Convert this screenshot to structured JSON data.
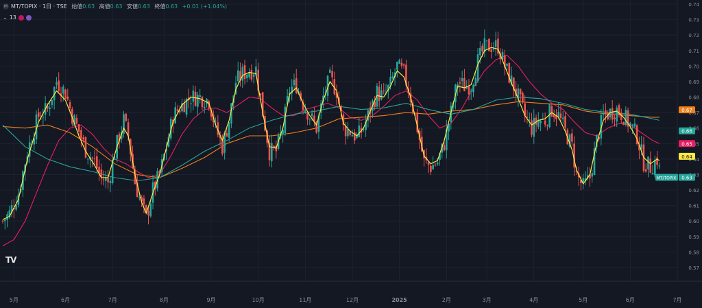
{
  "legend": {
    "symbol": "MT/TOPIX · 1日 · TSE",
    "open_label": "始値",
    "open": "0.63",
    "high_label": "高値",
    "high": "0.63",
    "low_label": "安値",
    "low": "0.63",
    "close_label": "終値",
    "close": "0.63",
    "change": "+0.01 (+1.04%)",
    "indicator_count": "13"
  },
  "colors": {
    "background": "#141823",
    "up": "#26a69a",
    "down": "#ef5350",
    "ma_fast": "#fbe945",
    "ma_teal": "#26a69a",
    "ma_orange": "#f0801c",
    "ma_pink": "#e91e63",
    "grid": "#1e2230",
    "axis_text": "#8b8f9a"
  },
  "icons": [
    "red-indicator-icon",
    "purple-indicator-icon"
  ],
  "chart_data": {
    "type": "candlestick",
    "title": "MT/TOPIX · 1日 · TSE",
    "ylim": [
      0.57,
      0.74
    ],
    "y_ticks": [
      "0.74",
      "0.73",
      "0.72",
      "0.71",
      "0.70",
      "0.69",
      "0.68",
      "0.67",
      "0.66",
      "0.65",
      "0.64",
      "0.63",
      "0.62",
      "0.61",
      "0.60",
      "0.59",
      "0.58",
      "0.57"
    ],
    "x_ticks": [
      "5月",
      "6月",
      "7月",
      "8月",
      "9月",
      "10月",
      "11月",
      "12月",
      "2025",
      "2月",
      "3月",
      "4月",
      "5月",
      "6月",
      "7月"
    ],
    "x_range": [
      0,
      301
    ],
    "last_bar_index": 293,
    "tick_positions": [
      5,
      28,
      49,
      72,
      93,
      114,
      135,
      156,
      177,
      198,
      216,
      237,
      259,
      280,
      301
    ],
    "price_path": [
      [
        0,
        0.6
      ],
      [
        3,
        0.605
      ],
      [
        7,
        0.618
      ],
      [
        11,
        0.645
      ],
      [
        16,
        0.668
      ],
      [
        20,
        0.672
      ],
      [
        24,
        0.69
      ],
      [
        28,
        0.683
      ],
      [
        31,
        0.668
      ],
      [
        34,
        0.658
      ],
      [
        37,
        0.646
      ],
      [
        41,
        0.638
      ],
      [
        44,
        0.628
      ],
      [
        47,
        0.625
      ],
      [
        51,
        0.65
      ],
      [
        54,
        0.665
      ],
      [
        56,
        0.655
      ],
      [
        59,
        0.625
      ],
      [
        62,
        0.61
      ],
      [
        64,
        0.602
      ],
      [
        67,
        0.62
      ],
      [
        70,
        0.63
      ],
      [
        73,
        0.648
      ],
      [
        76,
        0.668
      ],
      [
        80,
        0.675
      ],
      [
        84,
        0.68
      ],
      [
        88,
        0.68
      ],
      [
        92,
        0.678
      ],
      [
        95,
        0.66
      ],
      [
        98,
        0.648
      ],
      [
        101,
        0.665
      ],
      [
        104,
        0.69
      ],
      [
        107,
        0.695
      ],
      [
        110,
        0.697
      ],
      [
        113,
        0.698
      ],
      [
        116,
        0.67
      ],
      [
        119,
        0.645
      ],
      [
        122,
        0.645
      ],
      [
        125,
        0.66
      ],
      [
        128,
        0.685
      ],
      [
        131,
        0.688
      ],
      [
        134,
        0.676
      ],
      [
        137,
        0.668
      ],
      [
        140,
        0.66
      ],
      [
        143,
        0.68
      ],
      [
        146,
        0.692
      ],
      [
        149,
        0.684
      ],
      [
        152,
        0.66
      ],
      [
        155,
        0.658
      ],
      [
        158,
        0.654
      ],
      [
        161,
        0.66
      ],
      [
        164,
        0.672
      ],
      [
        167,
        0.683
      ],
      [
        170,
        0.68
      ],
      [
        173,
        0.688
      ],
      [
        176,
        0.7
      ],
      [
        179,
        0.695
      ],
      [
        182,
        0.68
      ],
      [
        185,
        0.66
      ],
      [
        188,
        0.638
      ],
      [
        191,
        0.635
      ],
      [
        194,
        0.638
      ],
      [
        197,
        0.65
      ],
      [
        200,
        0.67
      ],
      [
        203,
        0.69
      ],
      [
        206,
        0.687
      ],
      [
        209,
        0.688
      ],
      [
        212,
        0.703
      ],
      [
        215,
        0.712
      ],
      [
        218,
        0.713
      ],
      [
        221,
        0.713
      ],
      [
        224,
        0.7
      ],
      [
        227,
        0.69
      ],
      [
        230,
        0.68
      ],
      [
        233,
        0.668
      ],
      [
        236,
        0.66
      ],
      [
        239,
        0.665
      ],
      [
        242,
        0.665
      ],
      [
        245,
        0.672
      ],
      [
        248,
        0.668
      ],
      [
        251,
        0.658
      ],
      [
        254,
        0.648
      ],
      [
        256,
        0.63
      ],
      [
        259,
        0.622
      ],
      [
        262,
        0.628
      ],
      [
        265,
        0.652
      ],
      [
        268,
        0.668
      ],
      [
        271,
        0.67
      ],
      [
        274,
        0.672
      ],
      [
        277,
        0.668
      ],
      [
        280,
        0.662
      ],
      [
        283,
        0.655
      ],
      [
        286,
        0.638
      ],
      [
        289,
        0.635
      ],
      [
        292,
        0.64
      ],
      [
        293,
        0.633
      ]
    ],
    "series": [
      {
        "name": "MA fast",
        "color": "#fbe945",
        "last": "0.64",
        "points": [
          [
            0,
            0.601
          ],
          [
            3,
            0.603
          ],
          [
            7,
            0.614
          ],
          [
            11,
            0.64
          ],
          [
            16,
            0.664
          ],
          [
            20,
            0.675
          ],
          [
            24,
            0.684
          ],
          [
            28,
            0.678
          ],
          [
            31,
            0.667
          ],
          [
            34,
            0.655
          ],
          [
            37,
            0.645
          ],
          [
            41,
            0.636
          ],
          [
            44,
            0.628
          ],
          [
            47,
            0.628
          ],
          [
            51,
            0.648
          ],
          [
            54,
            0.66
          ],
          [
            56,
            0.655
          ],
          [
            59,
            0.63
          ],
          [
            62,
            0.612
          ],
          [
            64,
            0.605
          ],
          [
            67,
            0.618
          ],
          [
            70,
            0.63
          ],
          [
            73,
            0.647
          ],
          [
            76,
            0.664
          ],
          [
            80,
            0.675
          ],
          [
            84,
            0.68
          ],
          [
            88,
            0.679
          ],
          [
            92,
            0.676
          ],
          [
            95,
            0.662
          ],
          [
            98,
            0.652
          ],
          [
            101,
            0.665
          ],
          [
            104,
            0.685
          ],
          [
            107,
            0.694
          ],
          [
            110,
            0.696
          ],
          [
            113,
            0.695
          ],
          [
            116,
            0.67
          ],
          [
            119,
            0.648
          ],
          [
            122,
            0.647
          ],
          [
            125,
            0.66
          ],
          [
            128,
            0.682
          ],
          [
            131,
            0.686
          ],
          [
            134,
            0.676
          ],
          [
            137,
            0.668
          ],
          [
            140,
            0.662
          ],
          [
            143,
            0.678
          ],
          [
            146,
            0.69
          ],
          [
            149,
            0.684
          ],
          [
            152,
            0.663
          ],
          [
            155,
            0.658
          ],
          [
            158,
            0.655
          ],
          [
            161,
            0.66
          ],
          [
            164,
            0.671
          ],
          [
            167,
            0.681
          ],
          [
            170,
            0.68
          ],
          [
            173,
            0.687
          ],
          [
            176,
            0.697
          ],
          [
            179,
            0.693
          ],
          [
            182,
            0.68
          ],
          [
            185,
            0.661
          ],
          [
            188,
            0.642
          ],
          [
            191,
            0.637
          ],
          [
            194,
            0.639
          ],
          [
            197,
            0.652
          ],
          [
            200,
            0.67
          ],
          [
            203,
            0.687
          ],
          [
            206,
            0.686
          ],
          [
            209,
            0.688
          ],
          [
            212,
            0.701
          ],
          [
            215,
            0.71
          ],
          [
            218,
            0.712
          ],
          [
            221,
            0.711
          ],
          [
            224,
            0.7
          ],
          [
            227,
            0.689
          ],
          [
            230,
            0.679
          ],
          [
            233,
            0.668
          ],
          [
            236,
            0.662
          ],
          [
            239,
            0.665
          ],
          [
            242,
            0.666
          ],
          [
            245,
            0.67
          ],
          [
            248,
            0.667
          ],
          [
            251,
            0.658
          ],
          [
            254,
            0.646
          ],
          [
            256,
            0.633
          ],
          [
            259,
            0.624
          ],
          [
            262,
            0.63
          ],
          [
            265,
            0.65
          ],
          [
            268,
            0.665
          ],
          [
            271,
            0.67
          ],
          [
            274,
            0.671
          ],
          [
            277,
            0.667
          ],
          [
            280,
            0.661
          ],
          [
            283,
            0.653
          ],
          [
            286,
            0.641
          ],
          [
            289,
            0.637
          ],
          [
            292,
            0.64
          ],
          [
            293,
            0.639
          ]
        ]
      },
      {
        "name": "MA teal",
        "color": "#26a69a",
        "last": "0.66",
        "points": [
          [
            0,
            0.662
          ],
          [
            10,
            0.648
          ],
          [
            20,
            0.64
          ],
          [
            30,
            0.635
          ],
          [
            40,
            0.632
          ],
          [
            50,
            0.628
          ],
          [
            60,
            0.626
          ],
          [
            70,
            0.628
          ],
          [
            80,
            0.636
          ],
          [
            90,
            0.645
          ],
          [
            100,
            0.652
          ],
          [
            110,
            0.66
          ],
          [
            120,
            0.665
          ],
          [
            130,
            0.669
          ],
          [
            140,
            0.671
          ],
          [
            150,
            0.674
          ],
          [
            160,
            0.672
          ],
          [
            170,
            0.673
          ],
          [
            180,
            0.676
          ],
          [
            190,
            0.672
          ],
          [
            200,
            0.669
          ],
          [
            210,
            0.672
          ],
          [
            220,
            0.678
          ],
          [
            230,
            0.68
          ],
          [
            240,
            0.679
          ],
          [
            250,
            0.676
          ],
          [
            260,
            0.672
          ],
          [
            270,
            0.67
          ],
          [
            280,
            0.669
          ],
          [
            290,
            0.666
          ],
          [
            293,
            0.665
          ]
        ]
      },
      {
        "name": "MA orange",
        "color": "#f0801c",
        "last": "0.67",
        "points": [
          [
            0,
            0.661
          ],
          [
            10,
            0.66
          ],
          [
            20,
            0.662
          ],
          [
            30,
            0.657
          ],
          [
            40,
            0.648
          ],
          [
            50,
            0.637
          ],
          [
            60,
            0.63
          ],
          [
            70,
            0.628
          ],
          [
            80,
            0.634
          ],
          [
            90,
            0.641
          ],
          [
            100,
            0.65
          ],
          [
            110,
            0.655
          ],
          [
            120,
            0.655
          ],
          [
            130,
            0.657
          ],
          [
            140,
            0.66
          ],
          [
            150,
            0.666
          ],
          [
            160,
            0.667
          ],
          [
            170,
            0.668
          ],
          [
            180,
            0.67
          ],
          [
            190,
            0.669
          ],
          [
            200,
            0.671
          ],
          [
            210,
            0.672
          ],
          [
            220,
            0.675
          ],
          [
            230,
            0.677
          ],
          [
            240,
            0.676
          ],
          [
            250,
            0.675
          ],
          [
            260,
            0.671
          ],
          [
            270,
            0.669
          ],
          [
            280,
            0.668
          ],
          [
            290,
            0.667
          ],
          [
            293,
            0.667
          ]
        ]
      },
      {
        "name": "MA pink",
        "color": "#e91e63",
        "last": "0.65",
        "points": [
          [
            0,
            0.584
          ],
          [
            5,
            0.588
          ],
          [
            10,
            0.6
          ],
          [
            15,
            0.618
          ],
          [
            20,
            0.636
          ],
          [
            25,
            0.652
          ],
          [
            30,
            0.66
          ],
          [
            35,
            0.662
          ],
          [
            40,
            0.656
          ],
          [
            45,
            0.647
          ],
          [
            50,
            0.64
          ],
          [
            55,
            0.637
          ],
          [
            60,
            0.632
          ],
          [
            65,
            0.628
          ],
          [
            70,
            0.63
          ],
          [
            75,
            0.642
          ],
          [
            80,
            0.656
          ],
          [
            85,
            0.666
          ],
          [
            90,
            0.672
          ],
          [
            95,
            0.673
          ],
          [
            100,
            0.67
          ],
          [
            105,
            0.675
          ],
          [
            110,
            0.68
          ],
          [
            115,
            0.679
          ],
          [
            120,
            0.673
          ],
          [
            125,
            0.668
          ],
          [
            130,
            0.668
          ],
          [
            135,
            0.672
          ],
          [
            140,
            0.674
          ],
          [
            145,
            0.676
          ],
          [
            150,
            0.673
          ],
          [
            155,
            0.667
          ],
          [
            160,
            0.665
          ],
          [
            165,
            0.668
          ],
          [
            170,
            0.674
          ],
          [
            175,
            0.681
          ],
          [
            180,
            0.684
          ],
          [
            185,
            0.678
          ],
          [
            190,
            0.668
          ],
          [
            195,
            0.66
          ],
          [
            200,
            0.663
          ],
          [
            205,
            0.673
          ],
          [
            210,
            0.686
          ],
          [
            215,
            0.697
          ],
          [
            220,
            0.704
          ],
          [
            225,
            0.707
          ],
          [
            230,
            0.7
          ],
          [
            235,
            0.69
          ],
          [
            240,
            0.682
          ],
          [
            245,
            0.676
          ],
          [
            250,
            0.672
          ],
          [
            255,
            0.664
          ],
          [
            260,
            0.657
          ],
          [
            265,
            0.655
          ],
          [
            270,
            0.66
          ],
          [
            275,
            0.663
          ],
          [
            280,
            0.662
          ],
          [
            285,
            0.657
          ],
          [
            290,
            0.652
          ],
          [
            293,
            0.65
          ]
        ]
      }
    ],
    "last_price": "0.63",
    "last_price_label": "MT/TOPIX",
    "grid": true
  }
}
